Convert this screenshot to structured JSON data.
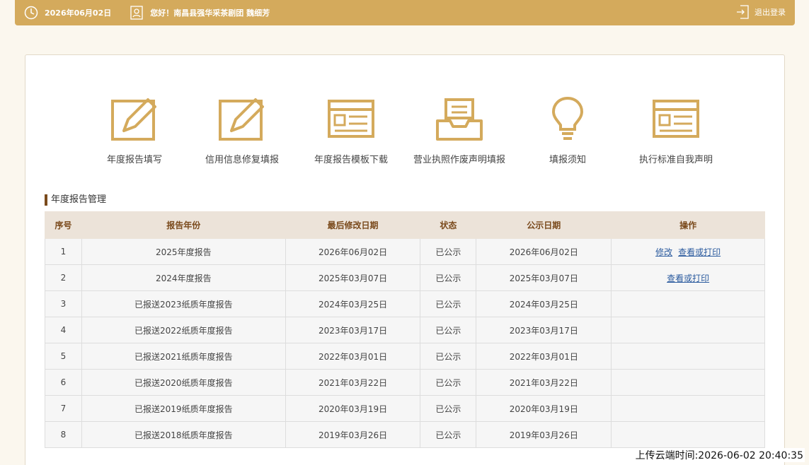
{
  "header": {
    "date": "2026年06月02日",
    "greeting": "您好！南昌县强华采茶剧团   魏细芳",
    "logout": "退出登录"
  },
  "shortcuts": [
    {
      "label": "年度报告填写",
      "icon": "edit-icon"
    },
    {
      "label": "信用信息修复填报",
      "icon": "edit-icon"
    },
    {
      "label": "年度报告模板下载",
      "icon": "template-icon"
    },
    {
      "label": "营业执照作废声明填报",
      "icon": "inbox-icon"
    },
    {
      "label": "填报须知",
      "icon": "lightbulb-icon"
    },
    {
      "label": "执行标准自我声明",
      "icon": "template-icon"
    }
  ],
  "section_title": "年度报告管理",
  "table": {
    "headers": [
      "序号",
      "报告年份",
      "最后修改日期",
      "状态",
      "公示日期",
      "操作"
    ],
    "rows": [
      {
        "no": "1",
        "year": "2025年度报告",
        "modified": "2026年06月02日",
        "status": "已公示",
        "published": "2026年06月02日",
        "actions": [
          "修改",
          "查看或打印"
        ]
      },
      {
        "no": "2",
        "year": "2024年度报告",
        "modified": "2025年03月07日",
        "status": "已公示",
        "published": "2025年03月07日",
        "actions": [
          "查看或打印"
        ]
      },
      {
        "no": "3",
        "year": "已报送2023纸质年度报告",
        "modified": "2024年03月25日",
        "status": "已公示",
        "published": "2024年03月25日",
        "actions": []
      },
      {
        "no": "4",
        "year": "已报送2022纸质年度报告",
        "modified": "2023年03月17日",
        "status": "已公示",
        "published": "2023年03月17日",
        "actions": []
      },
      {
        "no": "5",
        "year": "已报送2021纸质年度报告",
        "modified": "2022年03月01日",
        "status": "已公示",
        "published": "2022年03月01日",
        "actions": []
      },
      {
        "no": "6",
        "year": "已报送2020纸质年度报告",
        "modified": "2021年03月22日",
        "status": "已公示",
        "published": "2021年03月22日",
        "actions": []
      },
      {
        "no": "7",
        "year": "已报送2019纸质年度报告",
        "modified": "2020年03月19日",
        "status": "已公示",
        "published": "2020年03月19日",
        "actions": []
      },
      {
        "no": "8",
        "year": "已报送2018纸质年度报告",
        "modified": "2019年03月26日",
        "status": "已公示",
        "published": "2019年03月26日",
        "actions": []
      }
    ]
  },
  "timestamp": "上传云端时间:2026-06-02 20:40:35",
  "colors": {
    "accent": "#d4aa5c",
    "header_bg": "#ece3d9",
    "header_text": "#7a4a1c",
    "link": "#2a5a9e"
  }
}
